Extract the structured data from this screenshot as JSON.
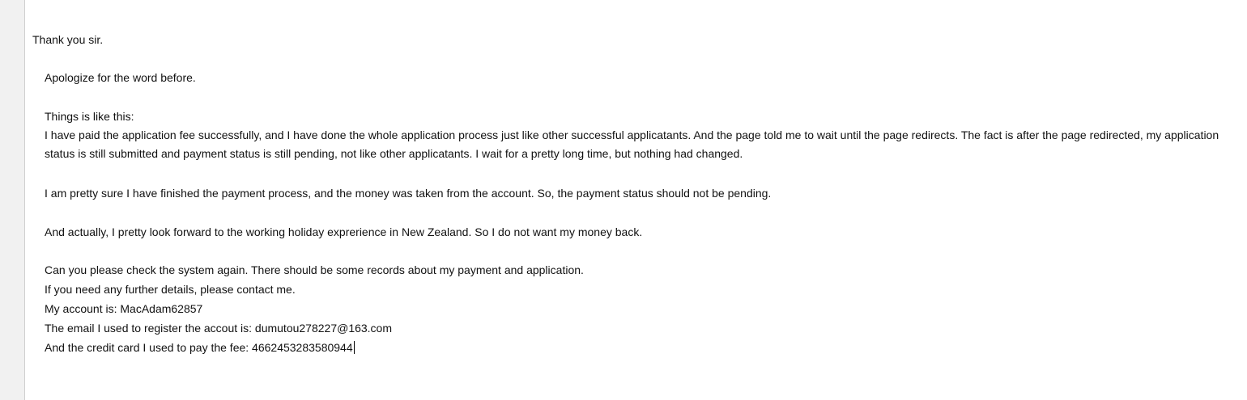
{
  "message": {
    "greeting": "Thank you sir.",
    "apology": "Apologize for the word before.",
    "intro": "Things is like this:",
    "paragraph_main": "I have paid the application fee successfully, and I have done the whole application process just like other successful applicatants. And the page told me to wait until the page redirects. The fact is after the page redirected, my application status is still submitted and payment status is still pending, not like other applicatants. I wait for a pretty long time, but nothing had changed.",
    "payment_note": "I am pretty sure I have finished the payment process, and the money was taken from the account. So, the payment status should not be pending.",
    "holiday_note": "And actually, I pretty look forward to the working holiday exprerience in New Zealand. So I do not want my money back.",
    "check_request": "Can you please check the system again. There should be some records about my payment and application.",
    "contact_request": "If you need any further details, please contact me.",
    "account_line": "My account is: MacAdam62857",
    "email_line": "The email I used to register the accout is: dumutou278227@163.com",
    "card_line": "And the credit card I used to pay the fee: 4662453283580944"
  }
}
